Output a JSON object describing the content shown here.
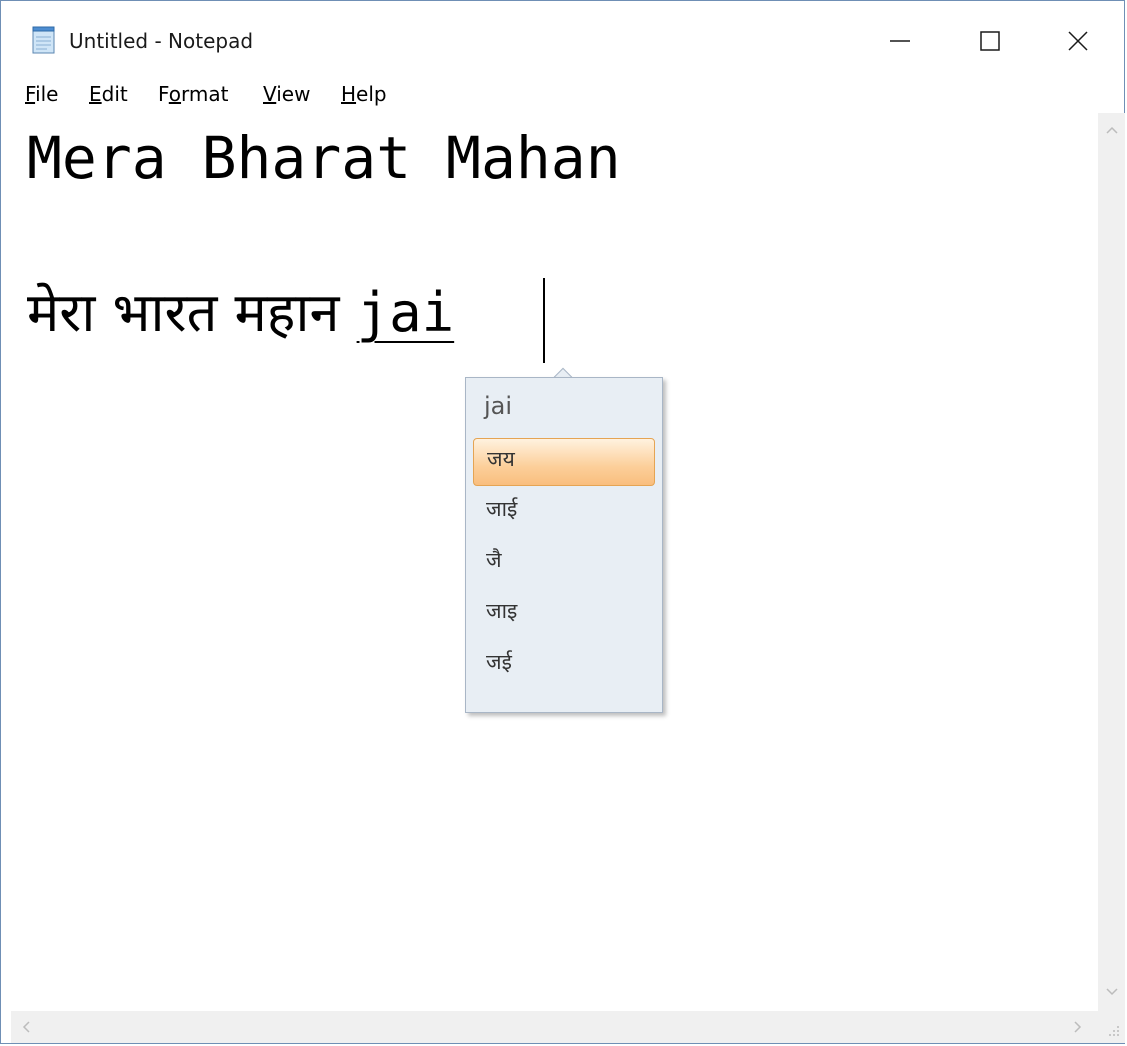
{
  "window": {
    "title": "Untitled - Notepad",
    "icon": "notepad-icon",
    "controls": [
      "minimize-icon",
      "maximize-icon",
      "close-icon"
    ]
  },
  "menu": {
    "file": {
      "accel": "F",
      "rest": "ile"
    },
    "edit": {
      "accel": "E",
      "rest": "dit"
    },
    "format": {
      "pre": "F",
      "accel": "o",
      "rest": "rmat"
    },
    "view": {
      "accel": "V",
      "rest": "iew"
    },
    "help": {
      "accel": "H",
      "rest": "elp"
    }
  },
  "editor": {
    "line1": "Mera Bharat Mahan",
    "line2_text": "मेरा भारत महान ",
    "composition": "jai"
  },
  "ime": {
    "input": "jai",
    "candidates": [
      "जय",
      "जाई",
      "जै",
      "जाइ",
      "जई"
    ],
    "selected_index": 0
  },
  "colors": {
    "window_border": "#6f8fb5",
    "ime_background": "#e8eef4",
    "selected_candidate": "#fccf9a",
    "scrollbar": "#f0f0f0"
  }
}
